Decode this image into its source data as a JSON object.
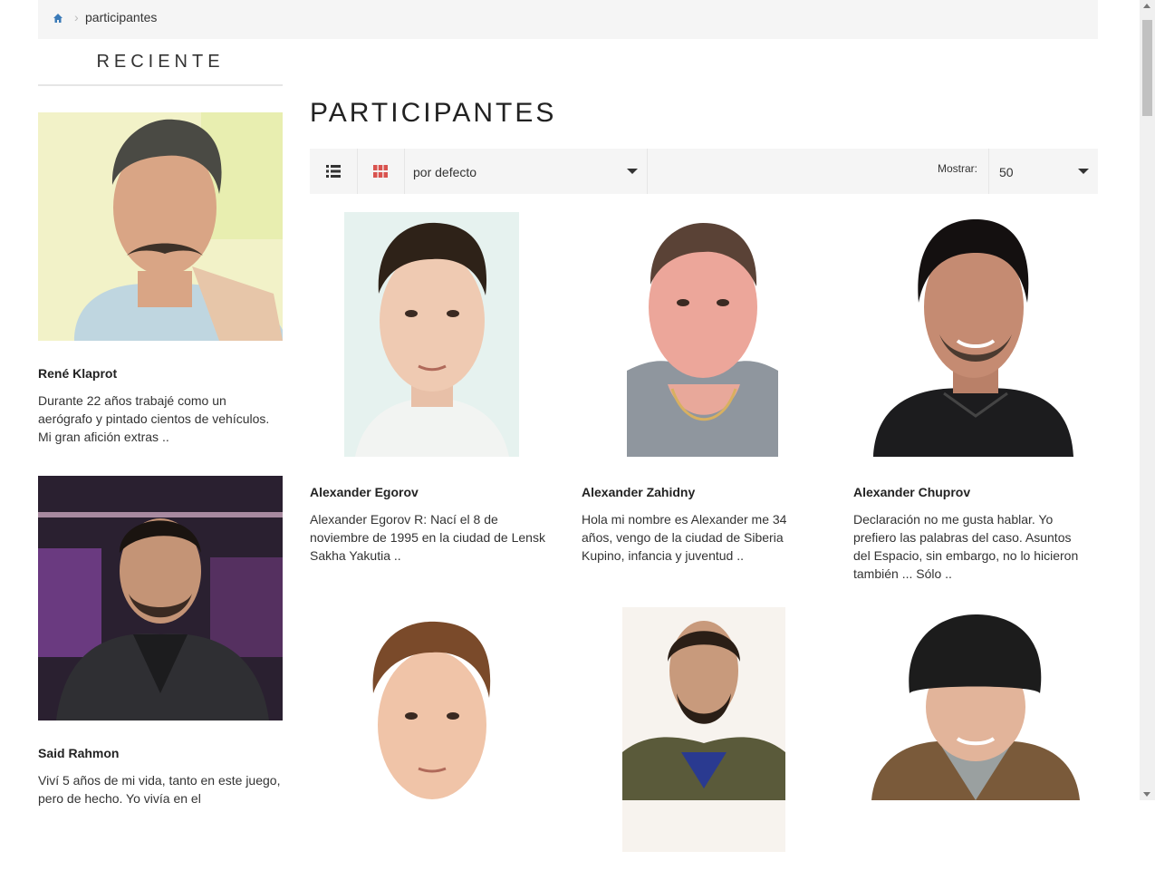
{
  "breadcrumb": {
    "home_icon": "home-icon",
    "separator": "›",
    "current": "participantes"
  },
  "sidebar": {
    "title": "RECIENTE",
    "items": [
      {
        "name": "René Klaprot",
        "description": "Durante 22 años trabajé como un aerógrafo y pintado cientos de vehículos. Mi gran afición extras .."
      },
      {
        "name": "Said Rahmon",
        "description": "Viví 5 años de mi vida, tanto en este juego, pero de hecho. Yo vivía en el"
      }
    ]
  },
  "main": {
    "title": "PARTICIPANTES",
    "toolbar": {
      "list_view_icon": "list-view-icon",
      "grid_view_icon": "grid-view-icon",
      "sort_value": "por defecto",
      "show_label": "Mostrar:",
      "show_value": "50"
    },
    "participants": [
      {
        "name": "Alexander Egorov",
        "description": "Alexander Egorov R: Nací el 8 de noviembre de 1995 en la ciudad de Lensk Sakha Yakutia .."
      },
      {
        "name": "Alexander Zahidny",
        "description": "Hola mi nombre es Alexander me 34 años, vengo de la ciudad de Siberia Kupino, infancia y juventud .."
      },
      {
        "name": "Alexander Chuprov",
        "description": "Declaración no me gusta hablar. Yo prefiero las palabras del caso. Asuntos del Espacio, sin embargo, no lo hicieron también ... Sólo .."
      },
      {
        "name": "",
        "description": ""
      },
      {
        "name": "",
        "description": ""
      },
      {
        "name": "",
        "description": ""
      }
    ]
  },
  "colors": {
    "accent_red": "#d9534f",
    "breadcrumb_bg": "#f5f5f5",
    "home_icon_blue": "#3a7ab8"
  }
}
